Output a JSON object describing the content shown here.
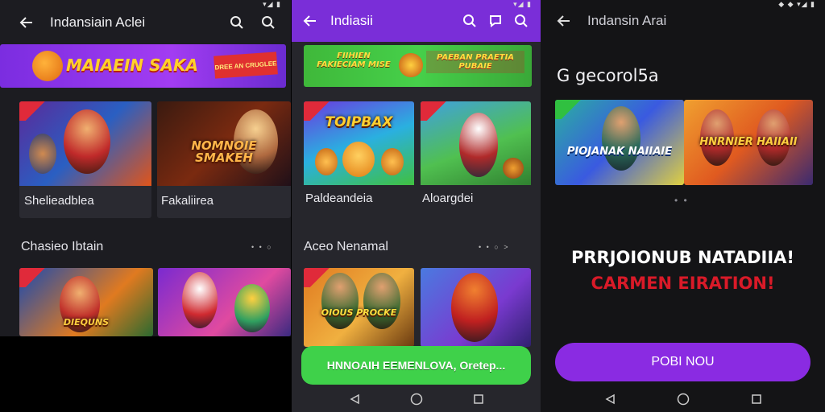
{
  "colors": {
    "purple": "#8a2be2",
    "green": "#3fd14a",
    "red": "#d91a28"
  },
  "panel1": {
    "status": "▾◢ ▮",
    "title": "Indansiain Aclei",
    "banner": {
      "text": "MAIAEIN SAKA",
      "badge": "DREE AN CRUGLEE"
    },
    "cards": [
      {
        "label": "Shelieadblea",
        "art_text": ""
      },
      {
        "label": "Fakaliirea",
        "art_text": "NOMNOIE SMAKEH"
      }
    ],
    "section": {
      "title": "Chasieo Ibtain",
      "more": "• • ○"
    },
    "cards2": [
      {
        "art_text": "DIEQUNS"
      },
      {
        "art_text": ""
      }
    ]
  },
  "panel2": {
    "status": "▾◢ ▮",
    "title": "Indiasii",
    "banner": {
      "text_left": "FIIHIEN FAKIECIAM MISE",
      "text_right": "PAEBAN PRAETIA PUBAIE"
    },
    "cards": [
      {
        "label": "Paldeandeia",
        "art_text": "TOIPBAX"
      },
      {
        "label": "Aloargdei",
        "art_text": ""
      }
    ],
    "section": {
      "title": "Aceo Nenamal",
      "more": "• • ○ >"
    },
    "cards2": [
      {
        "art_text": "OIOUS PROCKE"
      },
      {
        "art_text": ""
      }
    ],
    "cta": "HNNOAIH EEMENLOVA, Oretep..."
  },
  "panel3": {
    "status": "◆ ◆ ▾◢ ▮",
    "title": "Indansin Arai",
    "subtitle": "G gecorol5a",
    "cards": [
      {
        "art_text": "PIOJANAK NAIIAIE"
      },
      {
        "art_text": "HNRNIER HAIIAII"
      }
    ],
    "dots": "• •",
    "headline1": "PRRJOIONUB NATADIIA!",
    "headline2": "CARMEN EIRATION!",
    "cta": "POBI NOU"
  }
}
